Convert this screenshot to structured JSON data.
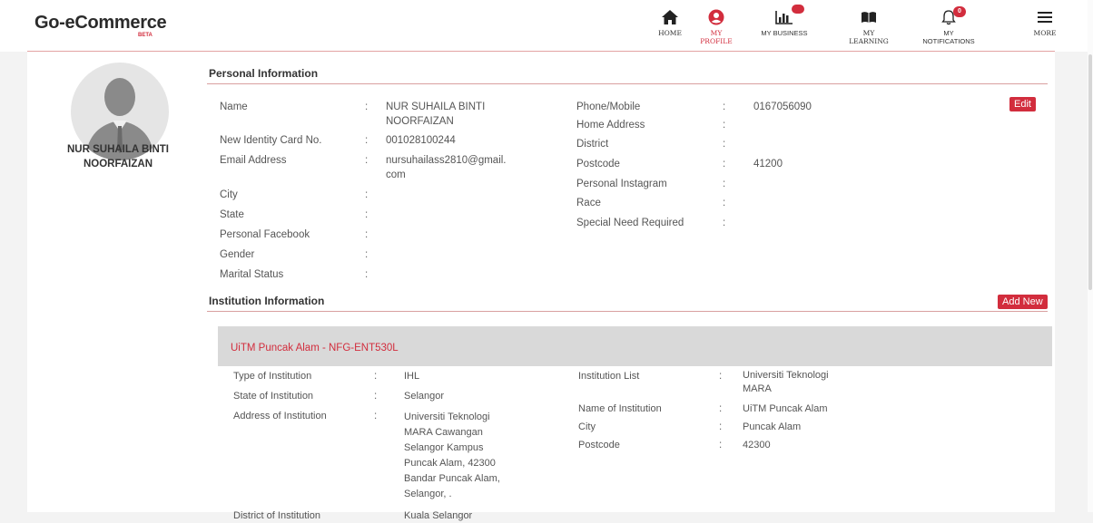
{
  "brand": {
    "name": "Go-eCommerce",
    "tag": "BETA"
  },
  "nav": {
    "home": "HOME",
    "profile": "MY PROFILE",
    "business": "MY BUSINESS",
    "learning": "MY LEARNING",
    "notifications": "MY NOTIFICATIONS",
    "notifications_count": "0",
    "more": "MORE"
  },
  "colors": {
    "accent": "#d22d3d"
  },
  "profile": {
    "name_line1": "NUR SUHAILA BINTI",
    "name_line2": "NOORFAIZAN"
  },
  "personal": {
    "title": "Personal Information",
    "edit_label": "Edit",
    "left": [
      {
        "label": "Name",
        "value_l1": "NUR SUHAILA BINTI",
        "value_l2": "NOORFAIZAN"
      },
      {
        "label": "New Identity Card No.",
        "value_l1": "001028100244"
      },
      {
        "label": "Email Address",
        "value_l1": "nursuhailass2810@gmail.",
        "value_l2": "com"
      },
      {
        "label": "City"
      },
      {
        "label": "State"
      },
      {
        "label": "Personal Facebook"
      },
      {
        "label": "Gender"
      },
      {
        "label": "Marital Status"
      }
    ],
    "right": [
      {
        "label": "Phone/Mobile",
        "value": "0167056090"
      },
      {
        "label": "Home Address"
      },
      {
        "label": "District"
      },
      {
        "label": "Postcode",
        "value": "41200"
      },
      {
        "label": "Personal Instagram"
      },
      {
        "label": "Race"
      },
      {
        "label": "Special Need Required"
      }
    ]
  },
  "institution": {
    "title": "Institution Information",
    "add_label": "Add New",
    "card_title": "UiTM Puncak Alam - NFG-ENT530L",
    "type_label": "Type of Institution",
    "type_value": "IHL",
    "state_label": "State of Institution",
    "state_value": "Selangor",
    "address_label": "Address of Institution",
    "address_lines": [
      "Universiti Teknologi",
      "MARA Cawangan",
      "Selangor Kampus",
      "Puncak Alam, 42300",
      "Bandar Puncak Alam,",
      "Selangor, ."
    ],
    "district_label": "District of Institution",
    "district_value": "Kuala Selangor",
    "list_label": "Institution List",
    "list_value_l1": "Universiti Teknologi",
    "list_value_l2": "MARA",
    "name_label": "Name of Institution",
    "name_value": "UiTM Puncak Alam",
    "city_label": "City",
    "city_value": "Puncak Alam",
    "postcode_label": "Postcode",
    "postcode_value": "42300"
  }
}
